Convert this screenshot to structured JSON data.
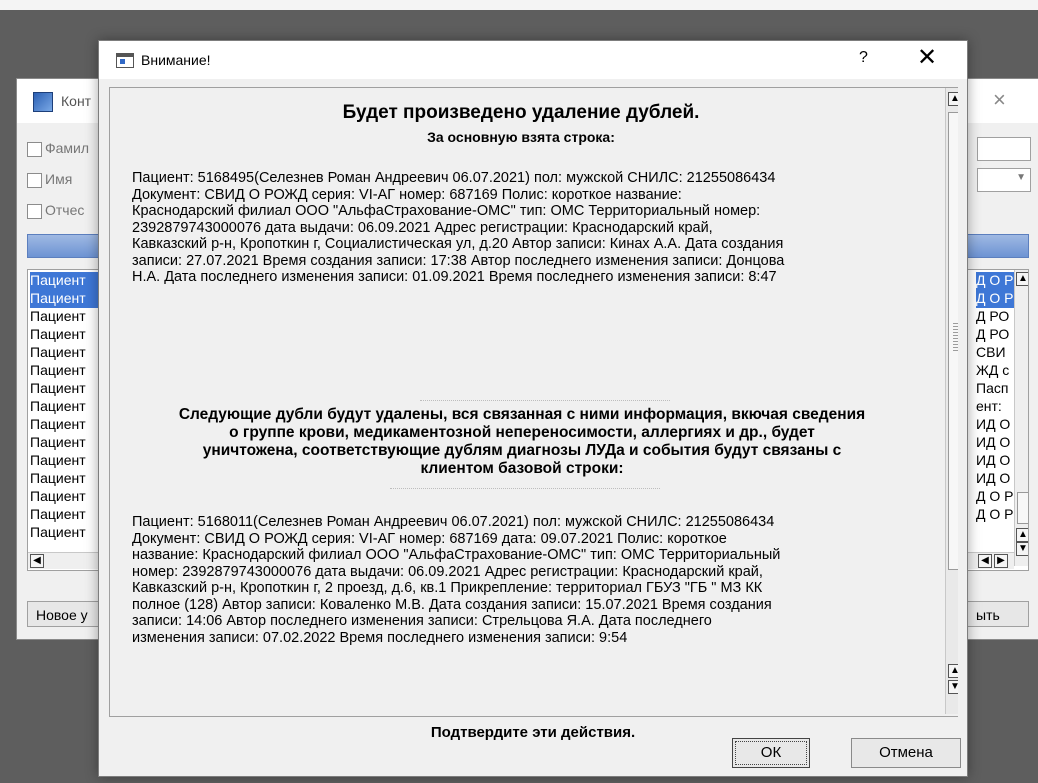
{
  "background_window": {
    "title": "Конт",
    "close_glyph": "×",
    "filters": [
      "Фамил",
      "Имя",
      "Отчес"
    ],
    "list_rows_left": [
      "Пациент",
      "Пациент",
      "Пациент",
      "Пациент",
      "Пациент",
      "Пациент",
      "Пациент",
      "Пациент",
      "Пациент",
      "Пациент",
      "Пациент",
      "Пациент",
      "Пациент",
      "Пациент",
      "Пациент"
    ],
    "list_rows_right": [
      "Д О Р",
      "Д О Р",
      "Д РО",
      "Д РО",
      "СВИ",
      "ЖД с",
      "Пасп",
      "ент:",
      "ИД О",
      "ИД О",
      "ИД О",
      "ИД О",
      "Д О Р",
      "Д О Р",
      ""
    ],
    "new_button": "Новое у",
    "close_button": "ыть"
  },
  "dialog": {
    "title": "Внимание!",
    "help_glyph": "?",
    "close_glyph": "✕",
    "heading": "Будет произведено удаление дублей.",
    "subheading": "За основную взята строка:",
    "main_record": "Пациент: 5168495(Селезнев Роман Андреевич 06.07.2021) пол: мужской  СНИЛС: 21255086434\nДокумент: СВИД О РОЖД серия: VI-АГ номер: 687169  Полис:  короткое название:\nКраснодарский филиал ООО \"АльфаСтрахование-ОМС\" тип: ОМС Территориальный номер:\n2392879743000076 дата выдачи: 06.09.2021  Адрес регистрации: Краснодарский край,\nКавказский р-н, Кропоткин г, Социалистическая ул, д.20 Автор записи: Кинах А.А. Дата создания\nзаписи: 27.07.2021 Время создания записи: 17:38 Автор последнего изменения записи: Донцова\nН.А. Дата последнего изменения записи: 01.09.2021 Время последнего изменения записи: 8:47",
    "warning": "Следующие дубли будут удалены, вся связанная с ними информация, вкючая сведения\nо группе крови, медикаментозной непереносимости, аллергиях и др., будет\nуничтожена, соответствующие дублям  диагнозы ЛУДа и события будут связаны с\nклиентом базовой строки:",
    "duplicate_record": "Пациент: 5168011(Селезнев Роман Андреевич 06.07.2021) пол: мужской  СНИЛС: 21255086434\nДокумент: СВИД О РОЖД серия: VI-АГ номер: 687169 дата: 09.07.2021  Полис:  короткое\nназвание: Краснодарский филиал ООО \"АльфаСтрахование-ОМС\" тип: ОМС Территориальный\nномер: 2392879743000076 дата выдачи: 06.09.2021  Адрес регистрации: Краснодарский край,\nКавказский р-н, Кропоткин г, 2 проезд, д.6, кв.1 Прикрепление: территориал ГБУЗ \"ГБ \" МЗ КК\nполное (128) Автор записи: Коваленко М.В. Дата создания записи: 15.07.2021 Время создания\nзаписи: 14:06 Автор последнего изменения записи: Стрельцова Я.А. Дата последнего\nизменения записи: 07.02.2022 Время последнего изменения записи: 9:54",
    "confirm": "Подтвердите эти действия.",
    "ok_label": "ОК",
    "cancel_label": "Отмена"
  }
}
